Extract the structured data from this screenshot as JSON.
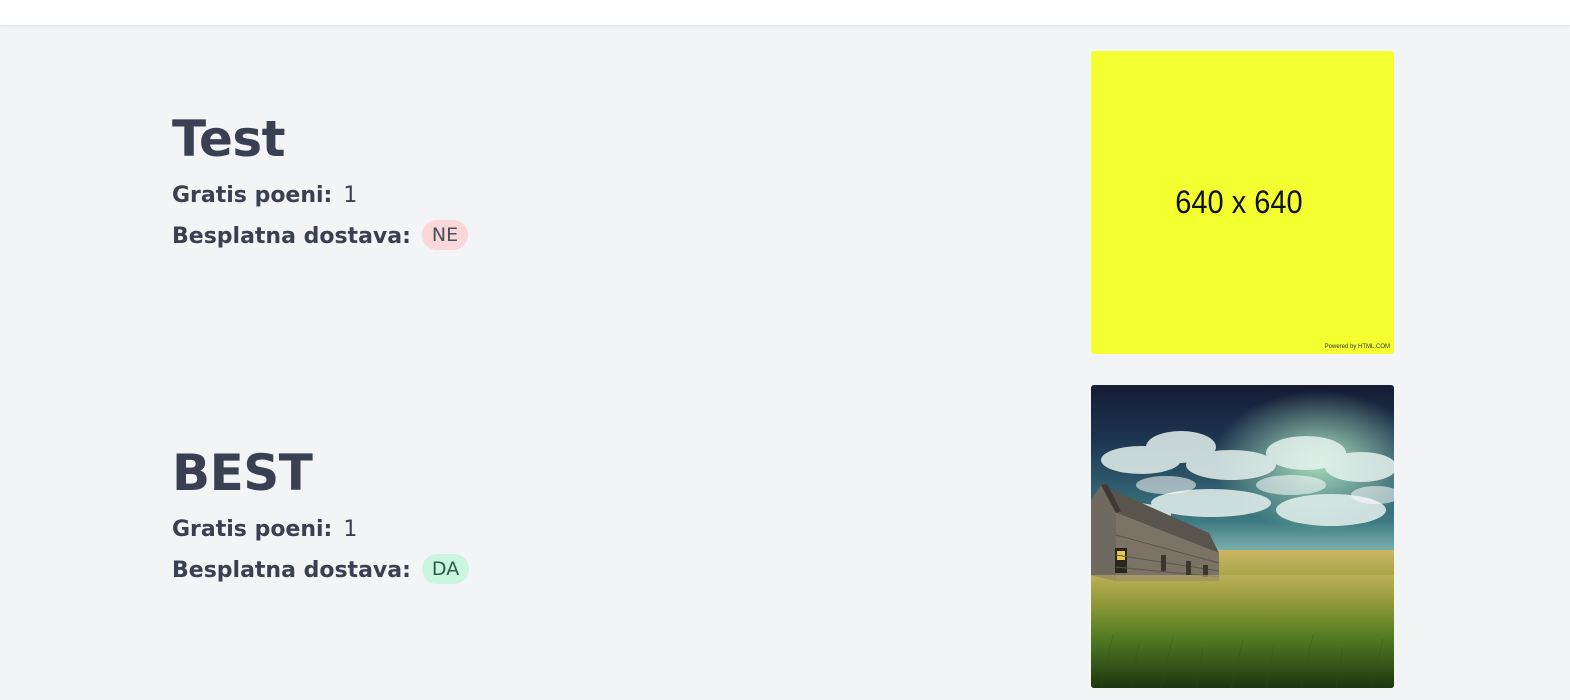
{
  "products": [
    {
      "title": "Test",
      "points_label": "Gratis poeni:",
      "points_value": "1",
      "delivery_label": "Besplatna dostava:",
      "delivery_badge": "NE",
      "delivery_free": false,
      "image": {
        "text": "640 x 640",
        "credit": "Powered by HTML.COM",
        "background": "#f3ff2f"
      }
    },
    {
      "title": "BEST",
      "points_label": "Gratis poeni:",
      "points_value": "1",
      "delivery_label": "Besplatna dostava:",
      "delivery_badge": "DA",
      "delivery_free": true,
      "image": {
        "kind": "photo-house-in-field"
      }
    }
  ],
  "colors": {
    "page_background": "#f3f4f6",
    "text": "#3a3f51",
    "badge_no_bg": "#fad7d9",
    "badge_yes_bg": "#c9f5e1"
  }
}
